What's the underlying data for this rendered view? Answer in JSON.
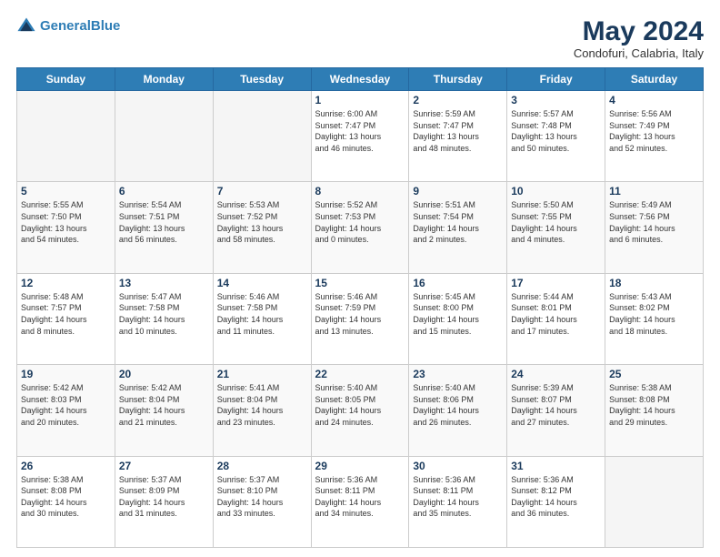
{
  "header": {
    "logo_line1": "General",
    "logo_line2": "Blue",
    "month": "May 2024",
    "location": "Condofuri, Calabria, Italy"
  },
  "weekdays": [
    "Sunday",
    "Monday",
    "Tuesday",
    "Wednesday",
    "Thursday",
    "Friday",
    "Saturday"
  ],
  "weeks": [
    [
      {
        "day": "",
        "info": ""
      },
      {
        "day": "",
        "info": ""
      },
      {
        "day": "",
        "info": ""
      },
      {
        "day": "1",
        "info": "Sunrise: 6:00 AM\nSunset: 7:47 PM\nDaylight: 13 hours\nand 46 minutes."
      },
      {
        "day": "2",
        "info": "Sunrise: 5:59 AM\nSunset: 7:47 PM\nDaylight: 13 hours\nand 48 minutes."
      },
      {
        "day": "3",
        "info": "Sunrise: 5:57 AM\nSunset: 7:48 PM\nDaylight: 13 hours\nand 50 minutes."
      },
      {
        "day": "4",
        "info": "Sunrise: 5:56 AM\nSunset: 7:49 PM\nDaylight: 13 hours\nand 52 minutes."
      }
    ],
    [
      {
        "day": "5",
        "info": "Sunrise: 5:55 AM\nSunset: 7:50 PM\nDaylight: 13 hours\nand 54 minutes."
      },
      {
        "day": "6",
        "info": "Sunrise: 5:54 AM\nSunset: 7:51 PM\nDaylight: 13 hours\nand 56 minutes."
      },
      {
        "day": "7",
        "info": "Sunrise: 5:53 AM\nSunset: 7:52 PM\nDaylight: 13 hours\nand 58 minutes."
      },
      {
        "day": "8",
        "info": "Sunrise: 5:52 AM\nSunset: 7:53 PM\nDaylight: 14 hours\nand 0 minutes."
      },
      {
        "day": "9",
        "info": "Sunrise: 5:51 AM\nSunset: 7:54 PM\nDaylight: 14 hours\nand 2 minutes."
      },
      {
        "day": "10",
        "info": "Sunrise: 5:50 AM\nSunset: 7:55 PM\nDaylight: 14 hours\nand 4 minutes."
      },
      {
        "day": "11",
        "info": "Sunrise: 5:49 AM\nSunset: 7:56 PM\nDaylight: 14 hours\nand 6 minutes."
      }
    ],
    [
      {
        "day": "12",
        "info": "Sunrise: 5:48 AM\nSunset: 7:57 PM\nDaylight: 14 hours\nand 8 minutes."
      },
      {
        "day": "13",
        "info": "Sunrise: 5:47 AM\nSunset: 7:58 PM\nDaylight: 14 hours\nand 10 minutes."
      },
      {
        "day": "14",
        "info": "Sunrise: 5:46 AM\nSunset: 7:58 PM\nDaylight: 14 hours\nand 11 minutes."
      },
      {
        "day": "15",
        "info": "Sunrise: 5:46 AM\nSunset: 7:59 PM\nDaylight: 14 hours\nand 13 minutes."
      },
      {
        "day": "16",
        "info": "Sunrise: 5:45 AM\nSunset: 8:00 PM\nDaylight: 14 hours\nand 15 minutes."
      },
      {
        "day": "17",
        "info": "Sunrise: 5:44 AM\nSunset: 8:01 PM\nDaylight: 14 hours\nand 17 minutes."
      },
      {
        "day": "18",
        "info": "Sunrise: 5:43 AM\nSunset: 8:02 PM\nDaylight: 14 hours\nand 18 minutes."
      }
    ],
    [
      {
        "day": "19",
        "info": "Sunrise: 5:42 AM\nSunset: 8:03 PM\nDaylight: 14 hours\nand 20 minutes."
      },
      {
        "day": "20",
        "info": "Sunrise: 5:42 AM\nSunset: 8:04 PM\nDaylight: 14 hours\nand 21 minutes."
      },
      {
        "day": "21",
        "info": "Sunrise: 5:41 AM\nSunset: 8:04 PM\nDaylight: 14 hours\nand 23 minutes."
      },
      {
        "day": "22",
        "info": "Sunrise: 5:40 AM\nSunset: 8:05 PM\nDaylight: 14 hours\nand 24 minutes."
      },
      {
        "day": "23",
        "info": "Sunrise: 5:40 AM\nSunset: 8:06 PM\nDaylight: 14 hours\nand 26 minutes."
      },
      {
        "day": "24",
        "info": "Sunrise: 5:39 AM\nSunset: 8:07 PM\nDaylight: 14 hours\nand 27 minutes."
      },
      {
        "day": "25",
        "info": "Sunrise: 5:38 AM\nSunset: 8:08 PM\nDaylight: 14 hours\nand 29 minutes."
      }
    ],
    [
      {
        "day": "26",
        "info": "Sunrise: 5:38 AM\nSunset: 8:08 PM\nDaylight: 14 hours\nand 30 minutes."
      },
      {
        "day": "27",
        "info": "Sunrise: 5:37 AM\nSunset: 8:09 PM\nDaylight: 14 hours\nand 31 minutes."
      },
      {
        "day": "28",
        "info": "Sunrise: 5:37 AM\nSunset: 8:10 PM\nDaylight: 14 hours\nand 33 minutes."
      },
      {
        "day": "29",
        "info": "Sunrise: 5:36 AM\nSunset: 8:11 PM\nDaylight: 14 hours\nand 34 minutes."
      },
      {
        "day": "30",
        "info": "Sunrise: 5:36 AM\nSunset: 8:11 PM\nDaylight: 14 hours\nand 35 minutes."
      },
      {
        "day": "31",
        "info": "Sunrise: 5:36 AM\nSunset: 8:12 PM\nDaylight: 14 hours\nand 36 minutes."
      },
      {
        "day": "",
        "info": ""
      }
    ]
  ]
}
